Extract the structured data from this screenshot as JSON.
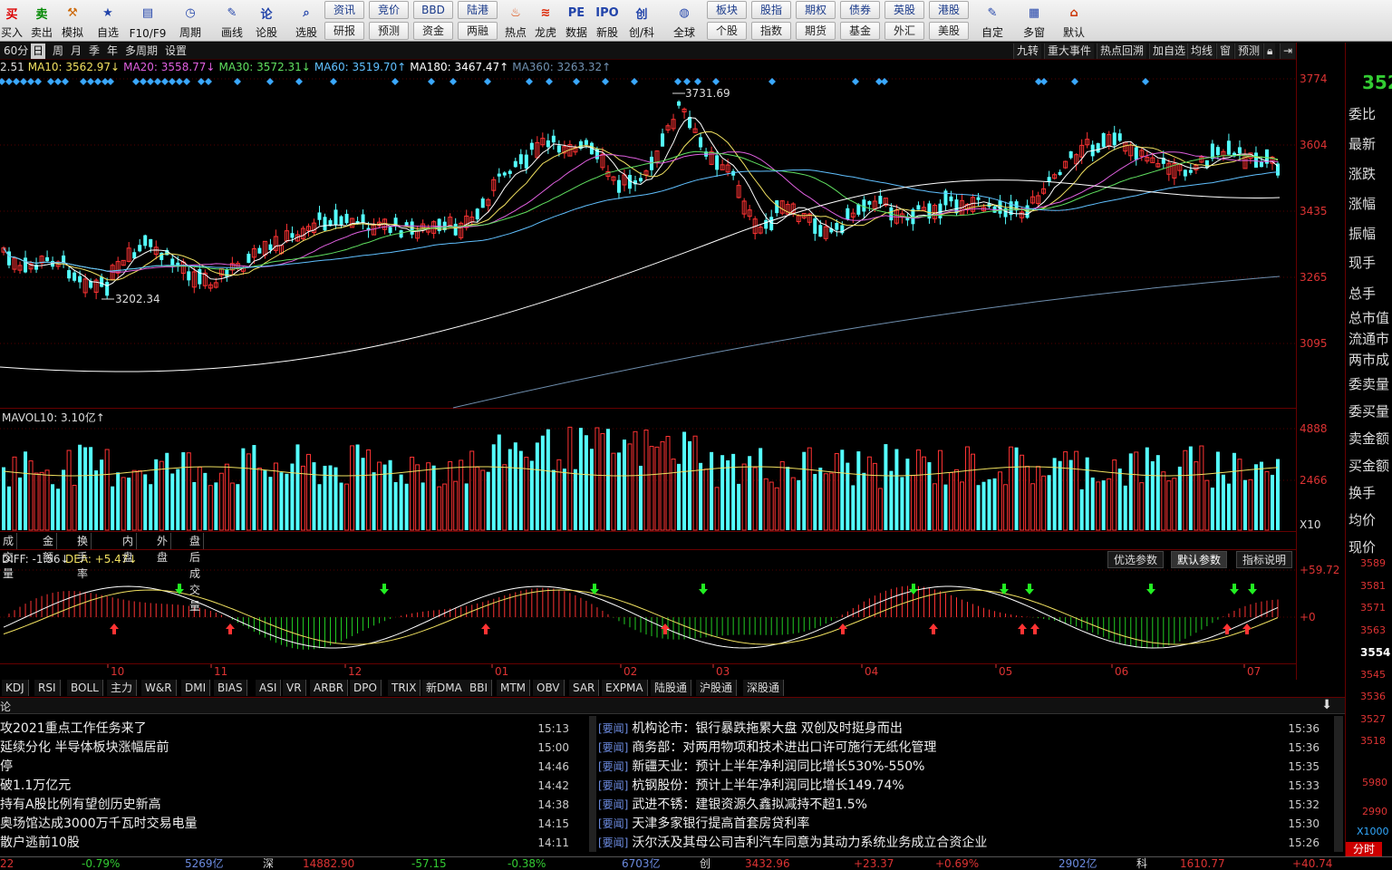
{
  "toolbar": {
    "left_items": [
      {
        "label": "买入",
        "icon": "buy-icon",
        "glyph": "买",
        "color": "#d00"
      },
      {
        "label": "卖出",
        "icon": "sell-icon",
        "glyph": "卖",
        "color": "#080"
      },
      {
        "label": "模拟",
        "icon": "hammer-icon",
        "glyph": "⚒",
        "color": "#c60"
      },
      {
        "label": "自选",
        "icon": "star-icon",
        "glyph": "★",
        "color": "#24a"
      },
      {
        "label": "F10/F9",
        "icon": "f10-icon",
        "glyph": "▤",
        "color": "#24a"
      },
      {
        "label": "周期",
        "icon": "clock-icon",
        "glyph": "◷",
        "color": "#24a"
      },
      {
        "label": "画线",
        "icon": "pen-icon",
        "glyph": "✎",
        "color": "#24a"
      },
      {
        "label": "论股",
        "icon": "discuss-icon",
        "glyph": "论",
        "color": "#24a"
      },
      {
        "label": "选股",
        "icon": "magnify-icon",
        "glyph": "⌕",
        "color": "#24a"
      }
    ],
    "button_grid": [
      {
        "top": "资讯",
        "bottom": "研报"
      },
      {
        "top": "竞价",
        "bottom": "预测"
      },
      {
        "top": "BBD",
        "bottom": "资金"
      },
      {
        "top": "陆港",
        "bottom": "两融"
      }
    ],
    "mid_items": [
      {
        "label": "热点",
        "icon": "hot-icon",
        "glyph": "♨",
        "color": "#d40"
      },
      {
        "label": "龙虎",
        "icon": "dragon-icon",
        "glyph": "≋",
        "color": "#d20"
      },
      {
        "label": "数据",
        "icon": "pe-icon",
        "glyph": "PE",
        "color": "#24a"
      },
      {
        "label": "新股",
        "icon": "ipo-icon",
        "glyph": "IPO",
        "color": "#24a"
      },
      {
        "label": "创/科",
        "icon": "chuang-icon",
        "glyph": "创",
        "color": "#24a"
      },
      {
        "label": "全球",
        "icon": "globe-icon",
        "glyph": "◍",
        "color": "#24a"
      }
    ],
    "button_grid2": [
      {
        "top": "板块",
        "bottom": "个股"
      },
      {
        "top": "股指",
        "bottom": "指数"
      },
      {
        "top": "期权",
        "bottom": "期货"
      },
      {
        "top": "债券",
        "bottom": "基金"
      },
      {
        "top": "英股",
        "bottom": "外汇"
      },
      {
        "top": "港股",
        "bottom": "美股"
      }
    ],
    "right_items": [
      {
        "label": "自定",
        "icon": "custom-icon",
        "glyph": "✎",
        "color": "#24a"
      },
      {
        "label": "多窗",
        "icon": "multiwindow-icon",
        "glyph": "▦",
        "color": "#24a"
      },
      {
        "label": "默认",
        "icon": "home-icon",
        "glyph": "⌂",
        "color": "#c30"
      }
    ]
  },
  "period_tabs": [
    "60分",
    "日",
    "周",
    "月",
    "季",
    "年",
    "多周期",
    "设置"
  ],
  "active_period": "日",
  "right_tabs": [
    "九转",
    "重大事件",
    "热点回溯",
    "加自选",
    "均线",
    "窗",
    "预测"
  ],
  "ma_legend": [
    {
      "text": "2.51",
      "color": "#ddd"
    },
    {
      "text": "MA10: 3562.97↓",
      "color": "#f0e060"
    },
    {
      "text": "MA20: 3558.77↓",
      "color": "#e060e0"
    },
    {
      "text": "MA30: 3572.31↓",
      "color": "#60e060"
    },
    {
      "text": "MA60: 3519.70↑",
      "color": "#60c0ff"
    },
    {
      "text": "MA180: 3467.47↑",
      "color": "#ffffff"
    },
    {
      "text": "MA360: 3263.32↑",
      "color": "#7090b0"
    }
  ],
  "price_axis": [
    "3774",
    "3604",
    "3435",
    "3265",
    "3095"
  ],
  "annotations": {
    "high": "3731.69",
    "low": "3202.34"
  },
  "volume": {
    "legend": "MAVOL10: 3.10亿↑",
    "axis": [
      "4888",
      "2466",
      "X10"
    ],
    "tabs": [
      "成交量",
      "金额",
      "换手率",
      "内盘",
      "外盘",
      "盘后成交量"
    ]
  },
  "macd": {
    "legend_diff": "DIFF: -1.56↓",
    "legend_dea": "DEA: +5.47↓",
    "axis": [
      "+59.72",
      "+0"
    ],
    "buttons": [
      "优选参数",
      "默认参数",
      "指标说明"
    ],
    "active_button": "默认参数"
  },
  "month_labels": [
    "10",
    "11",
    "12",
    "01",
    "02",
    "03",
    "04",
    "05",
    "06",
    "07"
  ],
  "indicator_tabs": [
    "KDJ",
    "RSI",
    "BOLL",
    "主力",
    "W&R",
    "DMI",
    "BIAS",
    "ASI",
    "VR",
    "ARBR",
    "DPO",
    "TRIX",
    "新DMA",
    "BBI",
    "MTM",
    "OBV",
    "SAR",
    "EXPMA",
    "陆股通",
    "沪股通",
    "深股通"
  ],
  "news": {
    "header": "论",
    "left": [
      {
        "title": "攻2021重点工作任务来了",
        "time": "15:13"
      },
      {
        "title": "延续分化 半导体板块涨幅居前",
        "time": "15:00"
      },
      {
        "title": "停",
        "time": "14:46"
      },
      {
        "title": "破1.1万亿元",
        "time": "14:42"
      },
      {
        "title": "持有A股比例有望创历史新高",
        "time": "14:38"
      },
      {
        "title": "奥场馆达成3000万千瓦时交易电量",
        "time": "14:15"
      },
      {
        "title": "散户逃前10股",
        "time": "14:11"
      }
    ],
    "right_tag": "[要闻]",
    "right": [
      {
        "title": "机构论市：银行暴跌拖累大盘 双创及时挺身而出",
        "time": "15:36"
      },
      {
        "title": "商务部：对两用物项和技术进出口许可施行无纸化管理",
        "time": "15:36"
      },
      {
        "title": "新疆天业：预计上半年净利润同比增长530%-550%",
        "time": "15:35"
      },
      {
        "title": "杭钢股份：预计上半年净利润同比增长149.74%",
        "time": "15:33"
      },
      {
        "title": "武进不锈：建银资源久鑫拟减持不超1.5%",
        "time": "15:32"
      },
      {
        "title": "天津多家银行提高首套房贷利率",
        "time": "15:30"
      },
      {
        "title": "沃尔沃及其母公司吉利汽车同意为其动力系统业务成立合资企业",
        "time": "15:26"
      }
    ]
  },
  "status": {
    "items": [
      {
        "text": "22",
        "color": "#d33"
      },
      {
        "text": "-0.79%",
        "color": "#3c3"
      },
      {
        "text": "5269亿",
        "color": "#6c8be0"
      },
      {
        "text": "深",
        "color": "#ddd"
      },
      {
        "text": "14882.90",
        "color": "#d33"
      },
      {
        "text": "-57.15",
        "color": "#3c3"
      },
      {
        "text": "-0.38%",
        "color": "#3c3"
      },
      {
        "text": "6703亿",
        "color": "#6c8be0"
      },
      {
        "text": "创",
        "color": "#ddd"
      },
      {
        "text": "3432.96",
        "color": "#d33"
      },
      {
        "text": "+23.37",
        "color": "#d33"
      },
      {
        "text": "+0.69%",
        "color": "#d33"
      },
      {
        "text": "2902亿",
        "color": "#6c8be0"
      },
      {
        "text": "科",
        "color": "#ddd"
      },
      {
        "text": "1610.77",
        "color": "#d33"
      },
      {
        "text": "+40.74",
        "color": "#d33"
      }
    ]
  },
  "right_panel": {
    "top_price": "352",
    "labels": [
      "委比",
      "最新",
      "涨跌",
      "涨幅",
      "振幅",
      "现手",
      "总手",
      "总市值",
      "流通市",
      "两市成",
      "委卖量",
      "委买量",
      "卖金额",
      "买金额",
      "换手",
      "均价",
      "现价"
    ],
    "price_ticks": [
      "3589",
      "3581",
      "3571",
      "3563",
      "3554",
      "3545",
      "3536",
      "3527",
      "3518"
    ],
    "vol_ticks": [
      "5980",
      "2990",
      "X1000"
    ],
    "timeshare": "分时"
  }
}
